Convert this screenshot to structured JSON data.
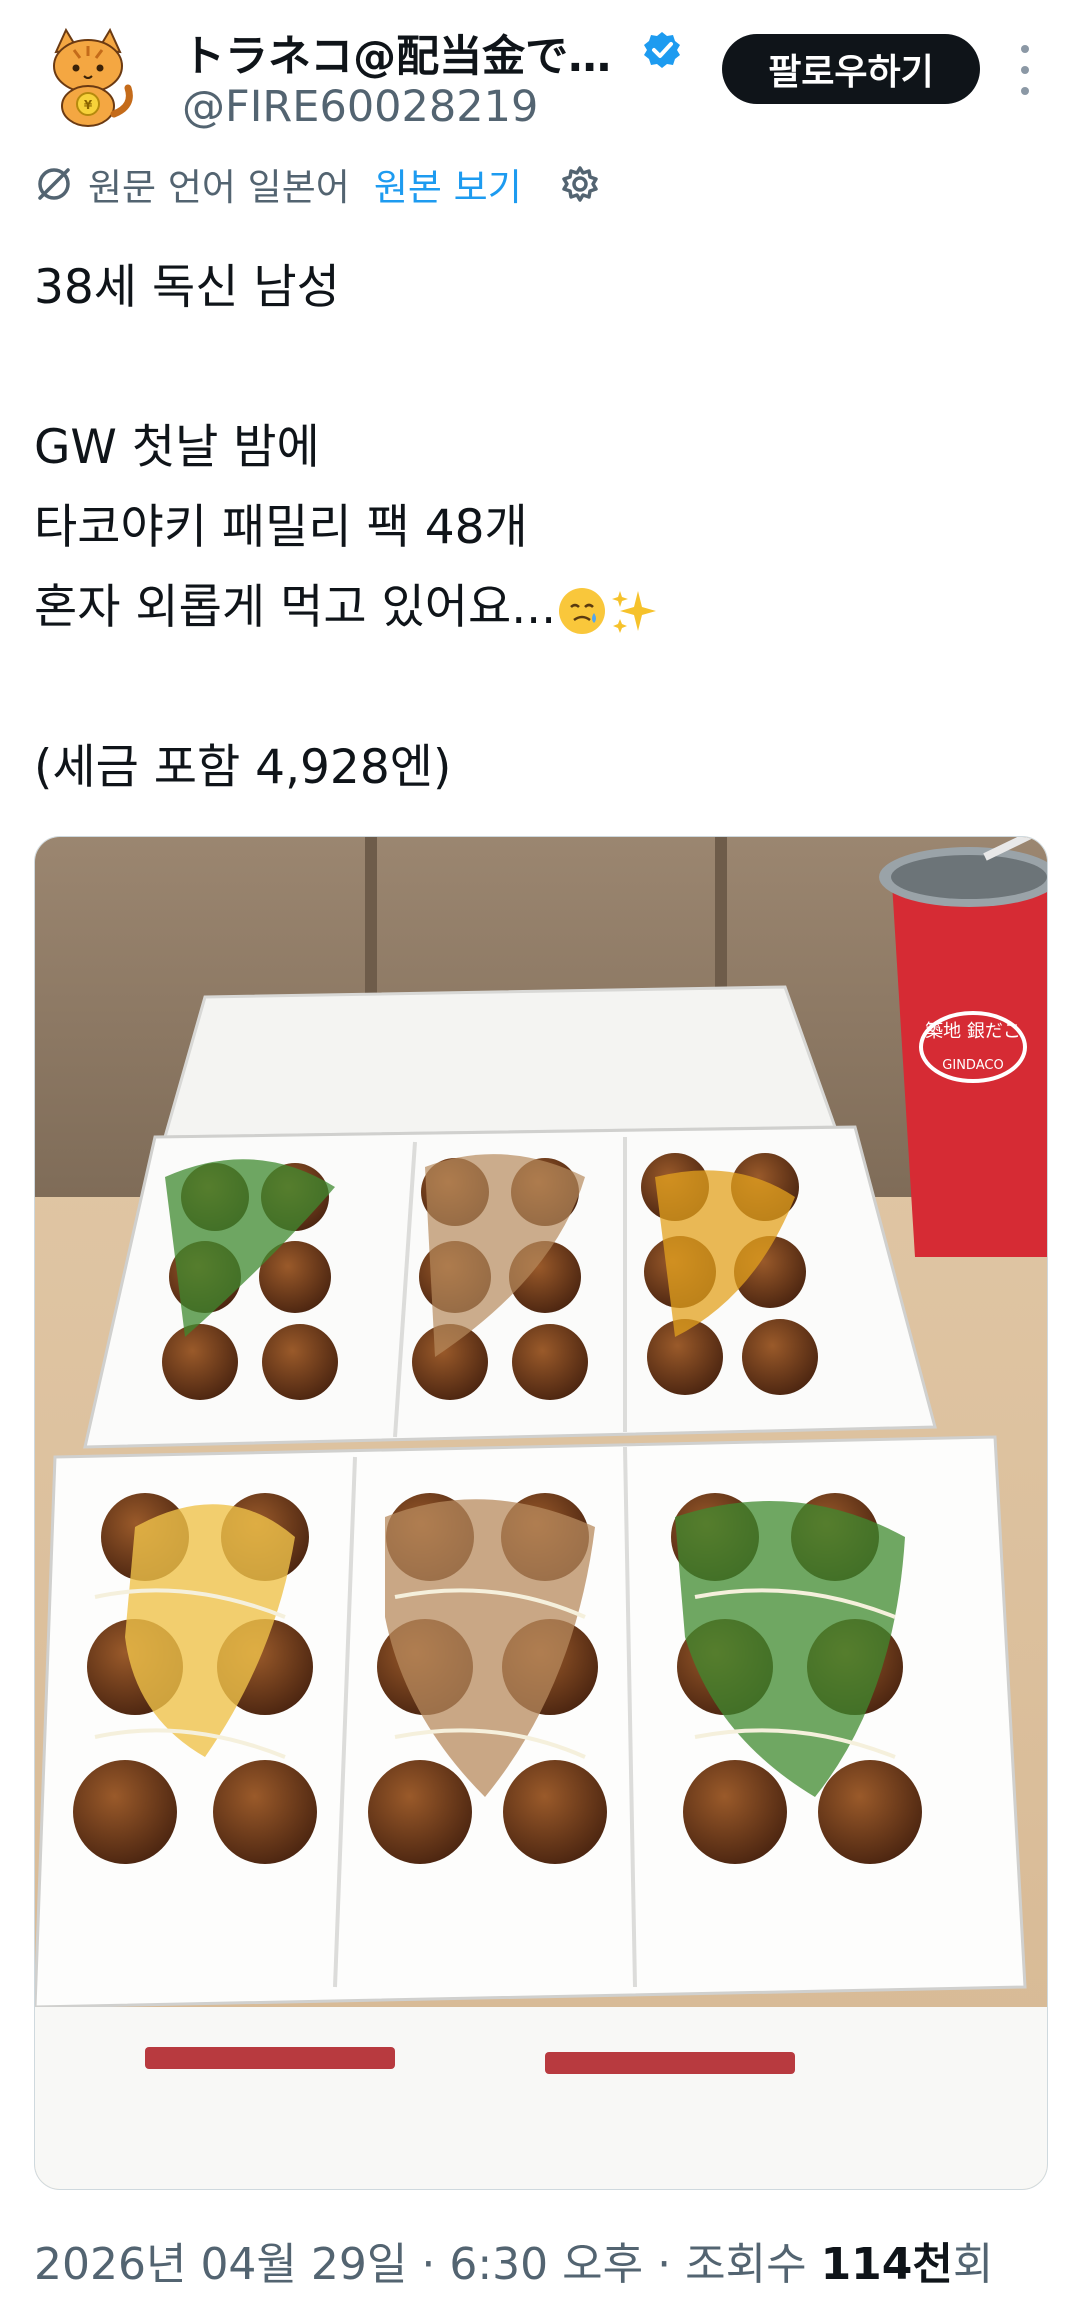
{
  "author": {
    "display_name": "トラネコ@配当金で…",
    "handle": "@FIRE60028219",
    "follow_label": "팔로우하기"
  },
  "translation": {
    "source_language": "원문 언어 일본어",
    "show_original": "원본 보기"
  },
  "tweet": {
    "line1": "38세 독신 남성",
    "line2": "GW 첫날 밤에",
    "line3": "타코야키 패밀리 팩 48개",
    "line4": "혼자 외롭게 먹고 있어요...",
    "line5": "(세금 포함 4,928엔)"
  },
  "photo": {
    "cup_brand": "築地 銀だこ",
    "cup_sub": "GINDACO"
  },
  "meta": {
    "date": "2026년 04월 29일",
    "time": "6:30 오후",
    "views_label": "조회수",
    "views_count": "114천",
    "views_suffix": "회"
  },
  "icons": {
    "verified": "verified-badge-icon",
    "translate": "translate-off-icon",
    "settings": "gear-icon",
    "more": "more-vertical-icon"
  },
  "colors": {
    "accent": "#1d9bf0",
    "text": "#0f1419",
    "muted": "#536471"
  }
}
